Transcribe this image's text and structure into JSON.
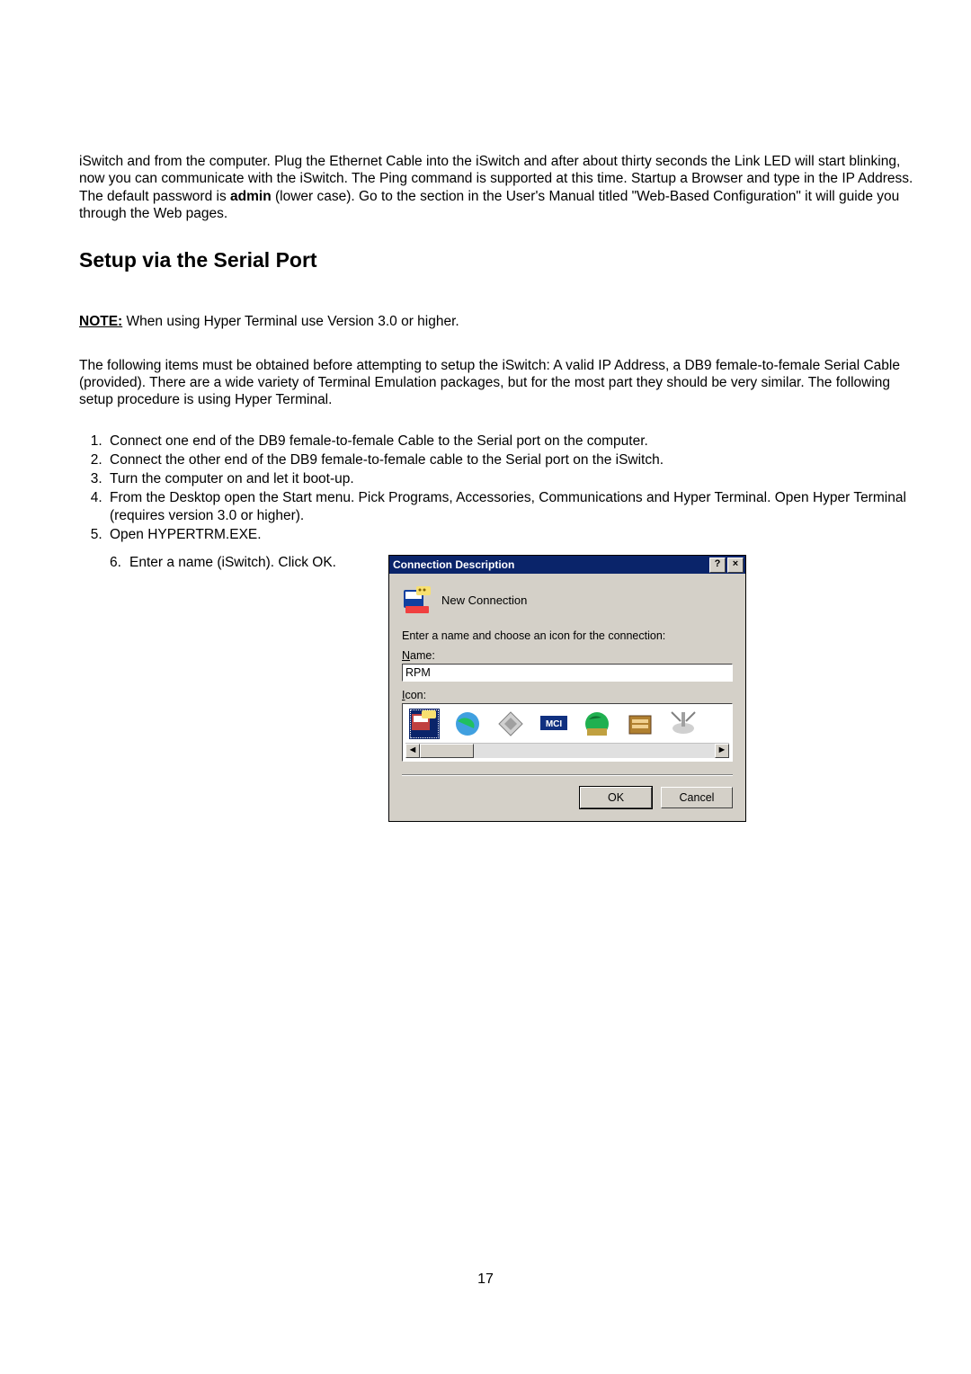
{
  "intro": {
    "pre": "iSwitch and from the computer.  Plug the Ethernet Cable into the iSwitch and after about thirty seconds the Link LED will start blinking, now you can communicate with the iSwitch.  The Ping command is supported at this time.  Startup a Browser and type in the IP Address.  The default password is ",
    "bold": "admin",
    "post": " (lower case).  Go to the section in the User's Manual titled \"Web-Based Configuration\" it will guide you through the Web pages."
  },
  "heading": "Setup via the Serial Port",
  "note": {
    "label": "NOTE:",
    "text": "  When using Hyper Terminal use Version 3.0 or higher."
  },
  "following": "The following items must be obtained before attempting to setup the iSwitch:  A valid IP Address, a DB9 female-to-female Serial Cable (provided).  There are a wide variety of Terminal Emulation packages, but for the most part they should be very similar.  The following setup procedure is using Hyper Terminal.",
  "steps": [
    "Connect one end of the DB9 female-to-female Cable to the Serial port on the computer.",
    "Connect the other end of the DB9 female-to-female cable to the Serial port on the iSwitch.",
    "Turn the computer on and let it boot-up.",
    "From the Desktop open the Start menu.  Pick Programs, Accessories, Communications and Hyper Terminal.  Open Hyper Terminal (requires version 3.0 or higher).",
    "Open HYPERTRM.EXE."
  ],
  "step6": {
    "number": "6.",
    "text": "Enter a name (iSwitch).  Click OK."
  },
  "dialog": {
    "title": "Connection Description",
    "help_glyph": "?",
    "close_glyph": "×",
    "newconn_label": "New Connection",
    "prompt": "Enter a name and choose an icon for the connection:",
    "name_underline": "N",
    "name_rest": "ame:",
    "name_value": "RPM",
    "icon_underline": "I",
    "icon_rest": "con:",
    "scroll_left": "◄",
    "scroll_right": "►",
    "ok": "OK",
    "cancel": "Cancel"
  },
  "page_number": "17"
}
